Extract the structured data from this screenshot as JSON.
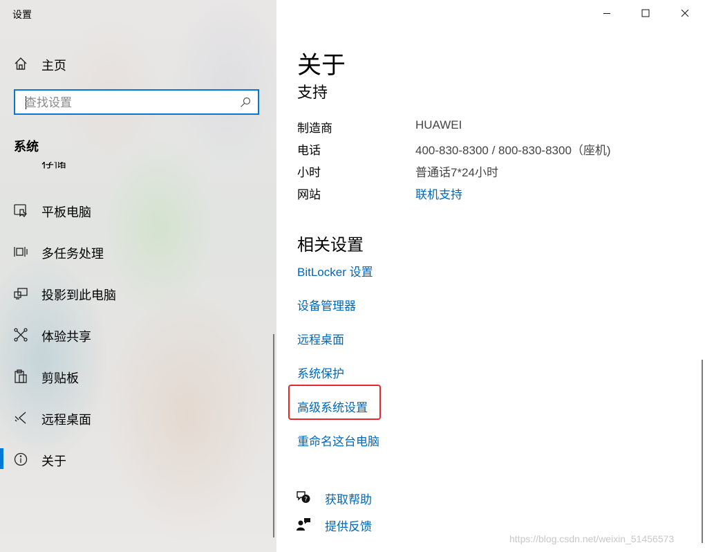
{
  "window": {
    "title": "设置",
    "controls": [
      "minimize-icon",
      "maximize-icon",
      "close-icon"
    ]
  },
  "sidebar": {
    "home_label": "主页",
    "search_placeholder": "查找设置",
    "section_label": "系统",
    "partial_item_label": "存储",
    "items": [
      {
        "label": "平板电脑",
        "icon": "tablet-mode-icon"
      },
      {
        "label": "多任务处理",
        "icon": "multitasking-icon"
      },
      {
        "label": "投影到此电脑",
        "icon": "project-to-pc-icon"
      },
      {
        "label": "体验共享",
        "icon": "shared-experiences-icon"
      },
      {
        "label": "剪贴板",
        "icon": "clipboard-icon"
      },
      {
        "label": "远程桌面",
        "icon": "remote-desktop-icon"
      },
      {
        "label": "关于",
        "icon": "about-info-icon",
        "active": true
      }
    ]
  },
  "main": {
    "title": "关于",
    "support": {
      "heading": "支持",
      "rows": [
        {
          "key": "制造商",
          "value": "HUAWEI"
        },
        {
          "key": "电话",
          "value": "400-830-8300 / 800-830-8300（座机)"
        },
        {
          "key": "小时",
          "value": "普通话7*24小时"
        },
        {
          "key": "网站",
          "value": "联机支持"
        }
      ]
    },
    "related": {
      "heading": "相关设置",
      "links": [
        "BitLocker 设置",
        "设备管理器",
        "远程桌面",
        "系统保护",
        "高级系统设置",
        "重命名这台电脑"
      ]
    },
    "help": [
      {
        "label": "获取帮助",
        "icon": "get-help-icon"
      },
      {
        "label": "提供反馈",
        "icon": "feedback-icon"
      }
    ],
    "watermark": "https://blog.csdn.net/weixin_51456573"
  },
  "colors": {
    "accent": "#0078d7",
    "link": "#0067b8",
    "highlight": "#e8262b"
  }
}
